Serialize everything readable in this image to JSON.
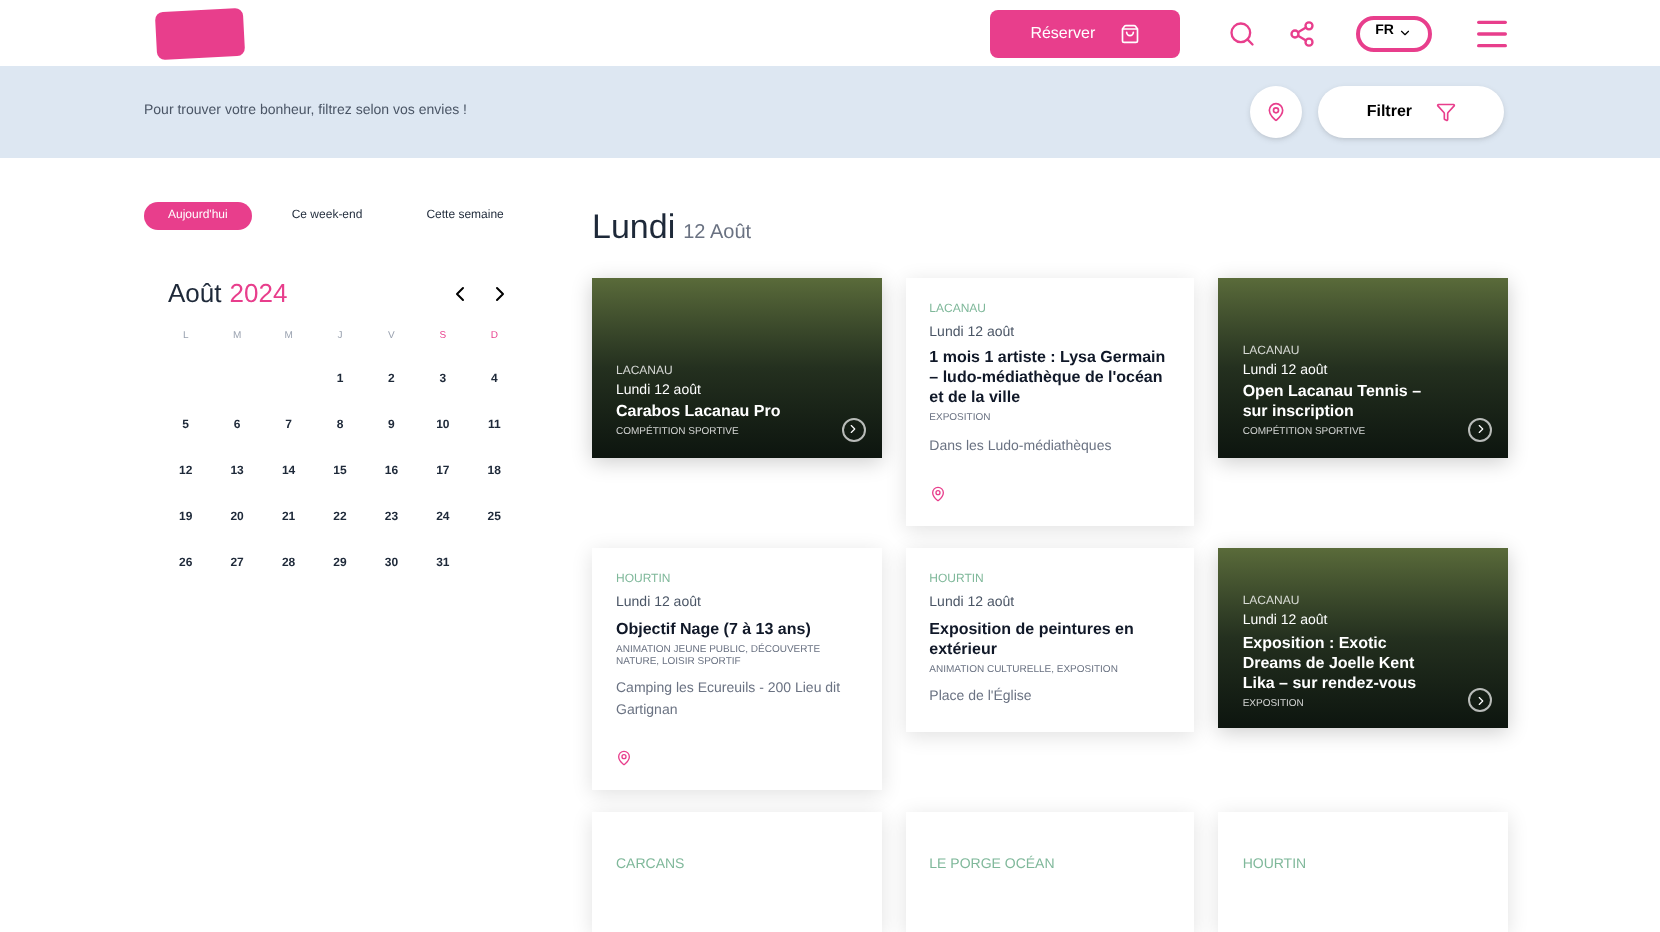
{
  "header": {
    "book_button": "Réserver",
    "language": "FR"
  },
  "filter_bar": {
    "hint": "Pour trouver votre bonheur, filtrez selon vos envies !",
    "filter_button": "Filtrer"
  },
  "period_tabs": [
    {
      "label": "Aujourd'hui",
      "selected": true
    },
    {
      "label": "Ce week-end",
      "selected": false
    },
    {
      "label": "Cette semaine",
      "selected": false
    }
  ],
  "calendar": {
    "month": "Août",
    "year": "2024",
    "weekdays": [
      {
        "label": "L",
        "weekend": false
      },
      {
        "label": "M",
        "weekend": false
      },
      {
        "label": "M",
        "weekend": false
      },
      {
        "label": "J",
        "weekend": false
      },
      {
        "label": "V",
        "weekend": false
      },
      {
        "label": "S",
        "weekend": true
      },
      {
        "label": "D",
        "weekend": true
      }
    ],
    "weeks": [
      [
        {
          "kind": "blank"
        },
        {
          "kind": "blank"
        },
        {
          "kind": "blank"
        },
        {
          "kind": "day",
          "label": "1"
        },
        {
          "kind": "day",
          "label": "2"
        },
        {
          "kind": "day",
          "label": "3"
        },
        {
          "kind": "day",
          "label": "4"
        }
      ],
      [
        {
          "kind": "day",
          "label": "5"
        },
        {
          "kind": "day",
          "label": "6"
        },
        {
          "kind": "day",
          "label": "7"
        },
        {
          "kind": "day",
          "label": "8"
        },
        {
          "kind": "day",
          "label": "9"
        },
        {
          "kind": "day",
          "label": "10"
        },
        {
          "kind": "day",
          "label": "11"
        }
      ],
      [
        {
          "kind": "day",
          "label": "12"
        },
        {
          "kind": "day",
          "label": "13"
        },
        {
          "kind": "day",
          "label": "14"
        },
        {
          "kind": "day",
          "label": "15"
        },
        {
          "kind": "day",
          "label": "16"
        },
        {
          "kind": "day",
          "label": "17"
        },
        {
          "kind": "day",
          "label": "18"
        }
      ],
      [
        {
          "kind": "day",
          "label": "19"
        },
        {
          "kind": "day",
          "label": "20"
        },
        {
          "kind": "day",
          "label": "21"
        },
        {
          "kind": "day",
          "label": "22"
        },
        {
          "kind": "day",
          "label": "23"
        },
        {
          "kind": "day",
          "label": "24"
        },
        {
          "kind": "day",
          "label": "25"
        }
      ],
      [
        {
          "kind": "day",
          "label": "26"
        },
        {
          "kind": "day",
          "label": "27"
        },
        {
          "kind": "day",
          "label": "28"
        },
        {
          "kind": "day",
          "label": "29"
        },
        {
          "kind": "day",
          "label": "30"
        },
        {
          "kind": "day",
          "label": "31"
        }
      ]
    ]
  },
  "day_heading": {
    "weekday": "Lundi",
    "date": "12 Août"
  },
  "events": [
    {
      "kind": "image",
      "location": "LACANAU",
      "date": "Lundi 12 août",
      "title": "Carabos Lacanau Pro",
      "tags": "COMPÉTITION SPORTIVE"
    },
    {
      "kind": "text",
      "location": "LACANAU",
      "date": "Lundi 12 août",
      "title": "1 mois 1 artiste : Lysa Germain – ludo-médiathèque de l'océan et de la ville",
      "tags": "EXPOSITION",
      "place": "Dans les Ludo-médiathèques",
      "map_link": true
    },
    {
      "kind": "image",
      "location": "LACANAU",
      "date": "Lundi 12 août",
      "title": "Open Lacanau Tennis – sur inscription",
      "tags": "COMPÉTITION SPORTIVE"
    },
    {
      "kind": "text",
      "location": "HOURTIN",
      "date": "Lundi 12 août",
      "title": "Objectif Nage (7 à 13 ans)",
      "tags": "ANIMATION JEUNE PUBLIC, DÉCOUVERTE NATURE, LOISIR SPORTIF",
      "place": "Camping les Ecureuils - 200 Lieu dit Gartignan",
      "map_link": true
    },
    {
      "kind": "text",
      "location": "HOURTIN",
      "date": "Lundi 12 août",
      "title": "Exposition de peintures en extérieur",
      "tags": "ANIMATION CULTURELLE, EXPOSITION",
      "place": "Place de l'Église",
      "map_link": false
    },
    {
      "kind": "image",
      "location": "LACANAU",
      "date": "Lundi 12 août",
      "title": "Exposition : Exotic Dreams de Joelle Kent Lika – sur rendez-vous",
      "tags": "EXPOSITION"
    },
    {
      "kind": "stub",
      "location": "CARCANS"
    },
    {
      "kind": "stub",
      "location": "LE PORGE OCÉAN"
    },
    {
      "kind": "stub",
      "location": "HOURTIN"
    }
  ]
}
